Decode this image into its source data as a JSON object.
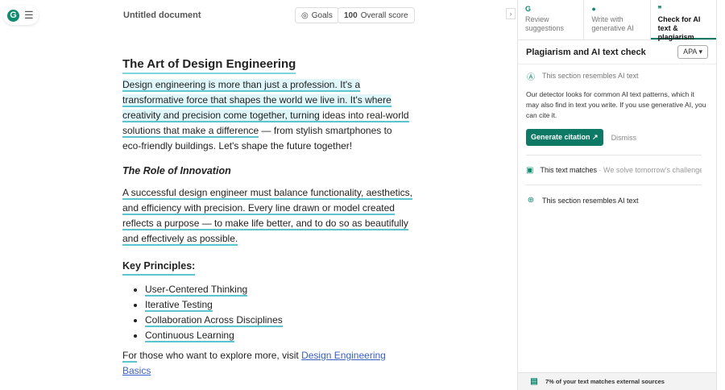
{
  "header": {
    "title": "Untitled document",
    "goals_label": "Goals",
    "score_value": "100",
    "score_label": "Overall score"
  },
  "doc": {
    "title": "The Art of Design Engineering",
    "p1_a": "Design engineering is more than just a profession. It's a transformative force that shapes the world we live in. It's where creativity and precision come together, turning",
    "p1_b": " ideas into real-world solutions that make a difference",
    "p1_c": " — from stylish smartphones to eco-friendly buildings. Let's shape the future together!",
    "h2": "The Role of Innovation",
    "p2": "A successful design engineer must balance functionality, aesthetics, and efficiency with precision. Every line drawn or model created reflects a purpose — to make life better, and to do so as beautifully and effectively as possible.",
    "h3": "Key Principles:",
    "principles": [
      "User-Centered Thinking",
      "Iterative Testing",
      "Collaboration Across Disciplines",
      "Continuous Learning"
    ],
    "p3_a": "For",
    "p3_b": " those who want to explore more, visit ",
    "link": "Design Engineering Basics"
  },
  "panel": {
    "tabs": [
      {
        "label": "Review suggestions"
      },
      {
        "label": "Write with generative AI"
      },
      {
        "label": "Check for AI text & plagiarism"
      }
    ],
    "heading": "Plagiarism and AI text check",
    "citation_style": "APA",
    "ai_notice": "This section resembles AI text",
    "description": "Our detector looks for common AI text patterns, which it may also find in text you write. If you use generative AI, you can cite it.",
    "generate_citation": "Generate citation",
    "dismiss": "Dismiss",
    "items": [
      {
        "label": "This text matches",
        "detail": " · We solve tomorrow's challenge..."
      },
      {
        "label": "This section resembles AI text",
        "detail": ""
      }
    ],
    "footer": "7% of your text matches external sources"
  }
}
